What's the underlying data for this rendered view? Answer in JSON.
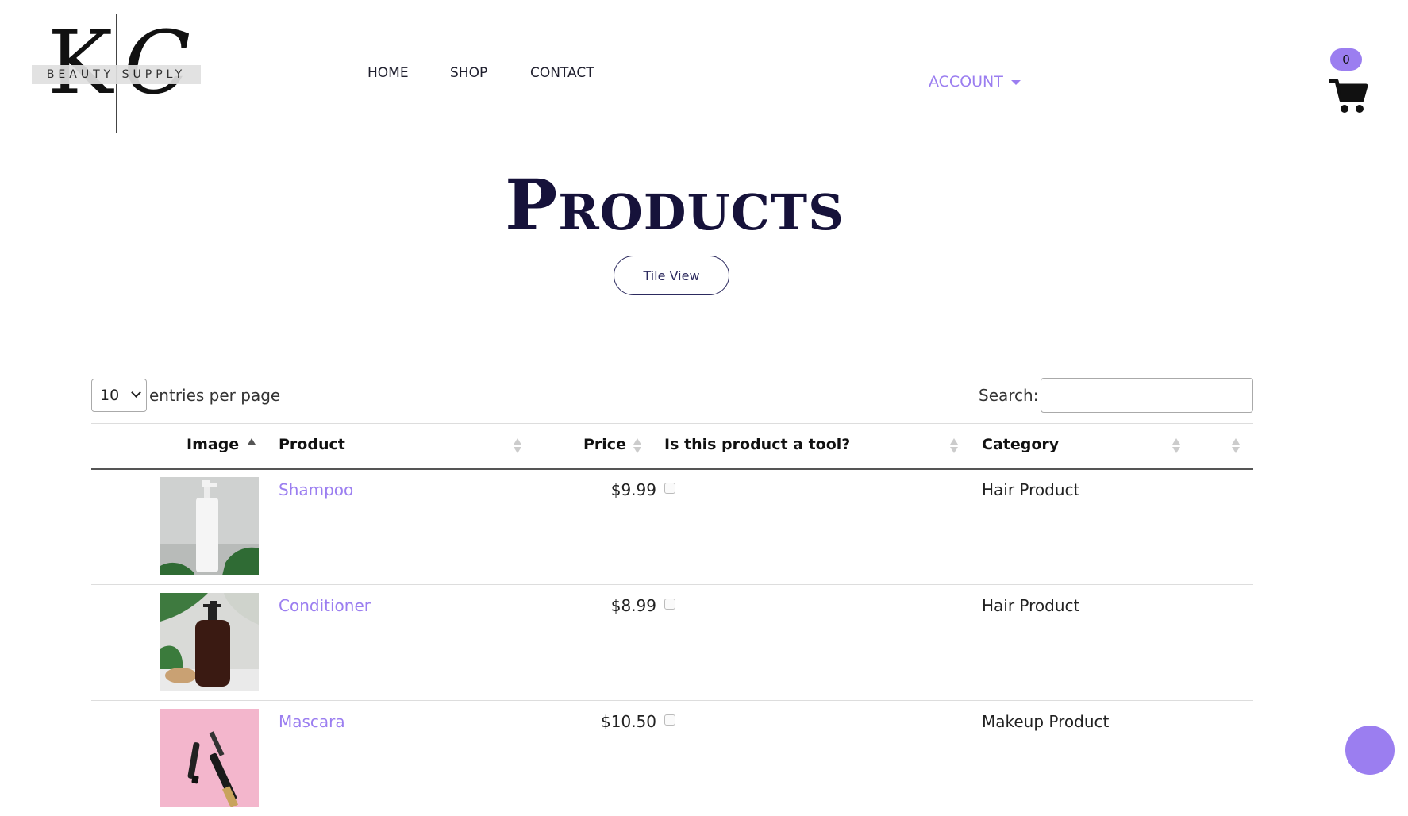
{
  "logo": {
    "letter_left": "K",
    "letter_right": "C",
    "tagline": "BEAUTY SUPPLY"
  },
  "nav": {
    "items": [
      "HOME",
      "SHOP",
      "CONTACT"
    ],
    "account_label": "ACCOUNT"
  },
  "cart": {
    "count": "0"
  },
  "page": {
    "title": "Products",
    "tile_view_label": "Tile View"
  },
  "table_controls": {
    "entries_value": "10",
    "entries_label": "entries per page",
    "search_label": "Search:"
  },
  "table": {
    "columns": [
      "Image",
      "Product",
      "Price",
      "Is this product a tool?",
      "Category"
    ],
    "rows": [
      {
        "product": "Shampoo",
        "price": "$9.99",
        "is_tool": false,
        "category": "Hair Product",
        "image_icon": "shampoo-bottle-image"
      },
      {
        "product": "Conditioner",
        "price": "$8.99",
        "is_tool": false,
        "category": "Hair Product",
        "image_icon": "conditioner-bottle-image"
      },
      {
        "product": "Mascara",
        "price": "$10.50",
        "is_tool": false,
        "category": "Makeup Product",
        "image_icon": "mascara-image"
      }
    ]
  },
  "colors": {
    "accent": "#9b7ef0",
    "title": "#16123a",
    "button_border": "#2c2a5e"
  }
}
